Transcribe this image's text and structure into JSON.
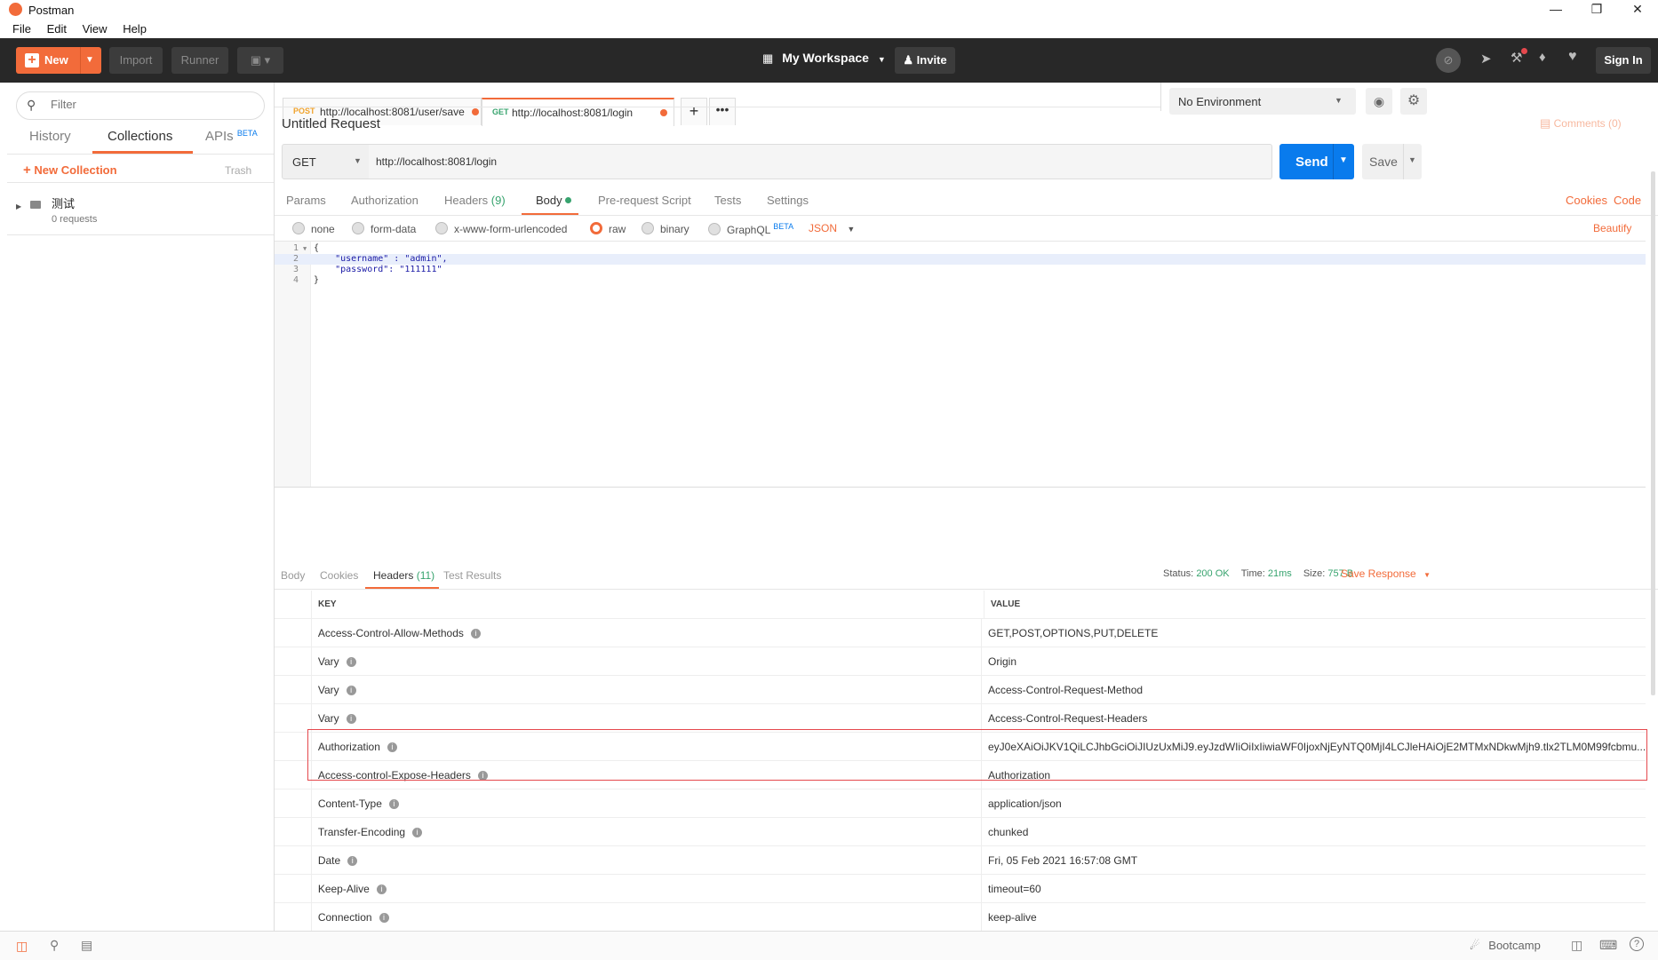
{
  "window": {
    "title": "Postman"
  },
  "menu": [
    "File",
    "Edit",
    "View",
    "Help"
  ],
  "header": {
    "new_label": "New",
    "import_label": "Import",
    "runner_label": "Runner",
    "workspace_label": "My Workspace",
    "invite_label": "Invite",
    "signin_label": "Sign In"
  },
  "sidebar": {
    "filter_placeholder": "Filter",
    "tabs": {
      "history": "History",
      "collections": "Collections",
      "apis": "APIs",
      "apis_badge": "BETA"
    },
    "new_collection": "New Collection",
    "trash": "Trash",
    "collection": {
      "name": "测试",
      "meta": "0 requests"
    }
  },
  "request_tabs": [
    {
      "method": "POST",
      "url": "http://localhost:8081/user/save"
    },
    {
      "method": "GET",
      "url": "http://localhost:8081/login"
    }
  ],
  "environment": {
    "selected": "No Environment"
  },
  "request": {
    "name": "Untitled Request",
    "comments": "Comments (0)",
    "method": "GET",
    "url": "http://localhost:8081/login",
    "send_label": "Send",
    "save_label": "Save",
    "subtabs": {
      "params": "Params",
      "authorization": "Authorization",
      "headers": "Headers",
      "headers_count": "(9)",
      "body": "Body",
      "prerequest": "Pre-request Script",
      "tests": "Tests",
      "settings": "Settings"
    },
    "cookies_link": "Cookies",
    "code_link": "Code",
    "body_modes": {
      "none": "none",
      "form_data": "form-data",
      "urlencoded": "x-www-form-urlencoded",
      "raw": "raw",
      "binary": "binary",
      "graphql": "GraphQL",
      "graphql_badge": "BETA",
      "format": "JSON"
    },
    "beautify": "Beautify",
    "body_lines": [
      {
        "num": "1",
        "text": "{"
      },
      {
        "num": "2",
        "text": "    \"username\" : \"admin\","
      },
      {
        "num": "3",
        "text": "    \"password\": \"111111\""
      },
      {
        "num": "4",
        "text": "}"
      }
    ]
  },
  "response": {
    "tabs": {
      "body": "Body",
      "cookies": "Cookies",
      "headers": "Headers",
      "headers_count": "(11)",
      "tests": "Test Results"
    },
    "status_label": "Status:",
    "status_value": "200 OK",
    "time_label": "Time:",
    "time_value": "21ms",
    "size_label": "Size:",
    "size_value": "757 B",
    "save_label": "Save Response",
    "columns": {
      "key": "KEY",
      "value": "VALUE"
    },
    "headers": [
      {
        "key": "Access-Control-Allow-Methods",
        "value": "GET,POST,OPTIONS,PUT,DELETE"
      },
      {
        "key": "Vary",
        "value": "Origin"
      },
      {
        "key": "Vary",
        "value": "Access-Control-Request-Method"
      },
      {
        "key": "Vary",
        "value": "Access-Control-Request-Headers"
      },
      {
        "key": "Authorization",
        "value": "eyJ0eXAiOiJKV1QiLCJhbGciOiJIUzUxMiJ9.eyJzdWIiOiIxIiwiaWF0IjoxNjEyNTQ0MjI4LCJleHAiOjE2MTMxNDkwMjh9.tlx2TLM0M99fcbmu..."
      },
      {
        "key": "Access-control-Expose-Headers",
        "value": "Authorization"
      },
      {
        "key": "Content-Type",
        "value": "application/json"
      },
      {
        "key": "Transfer-Encoding",
        "value": "chunked"
      },
      {
        "key": "Date",
        "value": "Fri, 05 Feb 2021 16:57:08 GMT"
      },
      {
        "key": "Keep-Alive",
        "value": "timeout=60"
      },
      {
        "key": "Connection",
        "value": "keep-alive"
      }
    ]
  },
  "footer": {
    "bootcamp": "Bootcamp"
  },
  "colors": {
    "accent": "#f26b3a",
    "send": "#097bed",
    "success": "#37a36e",
    "highlight": "#e5484d"
  }
}
